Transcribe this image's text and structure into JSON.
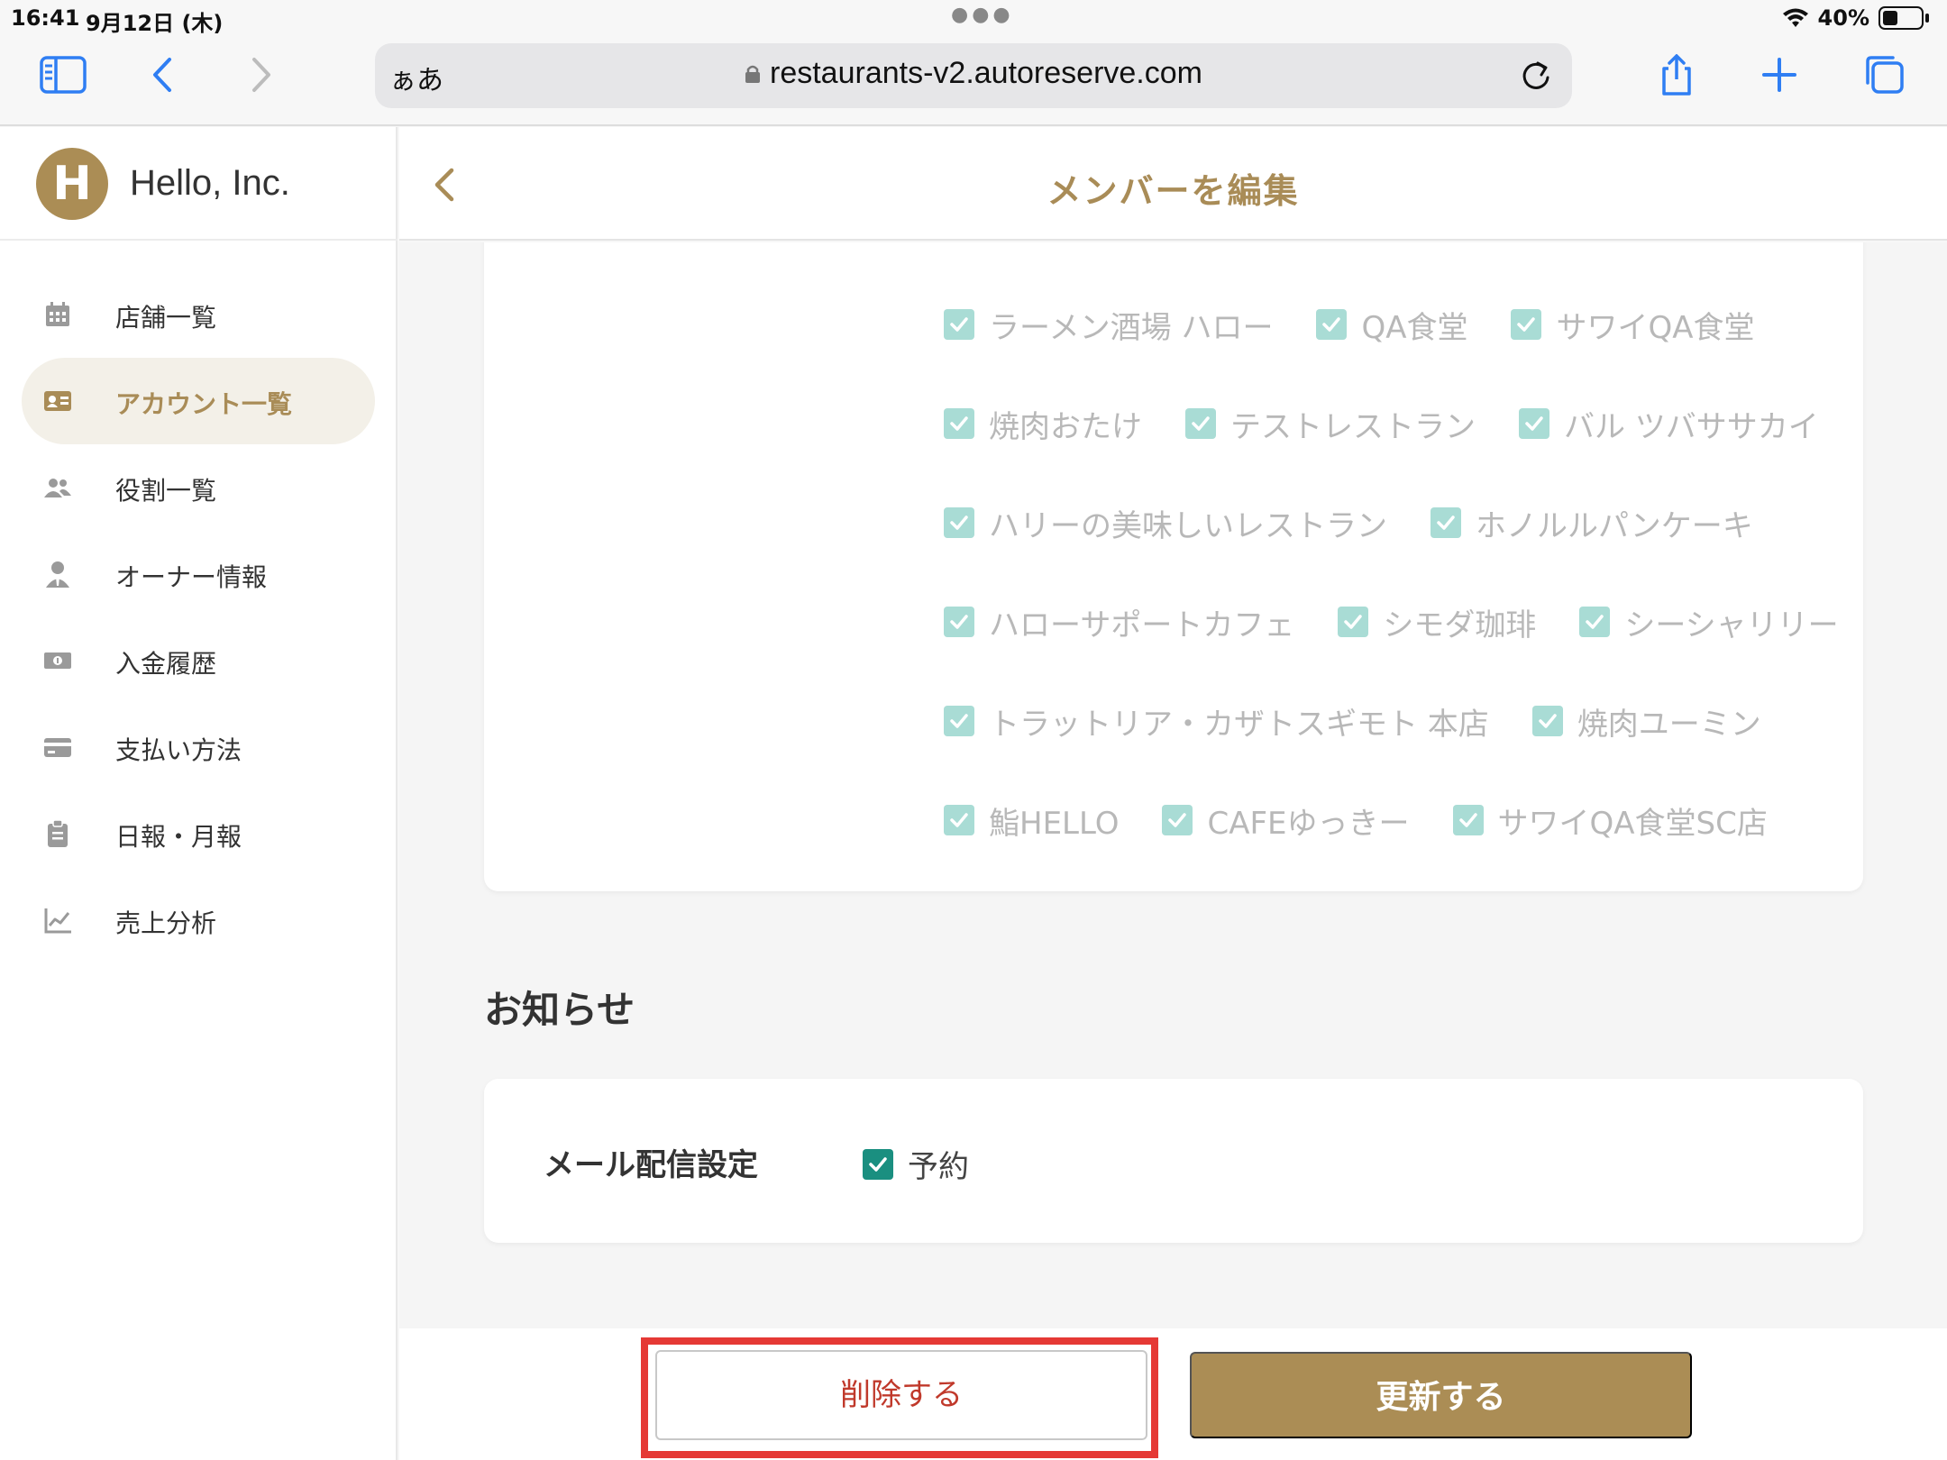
{
  "status_bar": {
    "time": "16:41",
    "date": "9月12日 (木)",
    "battery": "40%"
  },
  "browser": {
    "aa_label": "ぁあ",
    "url": "restaurants-v2.autoreserve.com"
  },
  "brand": {
    "initial": "H",
    "name": "Hello, Inc.",
    "color": "#ab8d55"
  },
  "sidebar": {
    "items": [
      {
        "label": "店舗一覧",
        "icon": "calendar-icon"
      },
      {
        "label": "アカウント一覧",
        "icon": "id-card-icon",
        "active": true
      },
      {
        "label": "役割一覧",
        "icon": "users-icon"
      },
      {
        "label": "オーナー情報",
        "icon": "user-tie-icon"
      },
      {
        "label": "入金履歴",
        "icon": "money-bill-icon"
      },
      {
        "label": "支払い方法",
        "icon": "credit-card-icon"
      },
      {
        "label": "日報・月報",
        "icon": "clipboard-icon"
      },
      {
        "label": "売上分析",
        "icon": "line-chart-icon"
      }
    ]
  },
  "header": {
    "title": "メンバーを編集"
  },
  "stores": {
    "rows": [
      [
        "ラーメン酒場 ハロー",
        "QA食堂",
        "サワイQA食堂"
      ],
      [
        "焼肉おたけ",
        "テストレストラン",
        "バル ツバササカイ"
      ],
      [
        "ハリーの美味しいレストラン",
        "ホノルルパンケーキ"
      ],
      [
        "ハローサポートカフェ",
        "シモダ珈琲",
        "シーシャリリー"
      ],
      [
        "トラットリア・カザトスギモト 本店",
        "焼肉ユーミン"
      ],
      [
        "鮨HELLO",
        "CAFEゆっきー",
        "サワイQA食堂SC店"
      ]
    ],
    "all_checked": true
  },
  "notifications": {
    "section_title": "お知らせ",
    "mail_label": "メール配信設定",
    "option_label": "予約",
    "option_checked": true
  },
  "actions": {
    "delete_label": "削除する",
    "update_label": "更新する"
  },
  "colors": {
    "accent": "#ab8d55",
    "check_disabled": "#a9dcd5",
    "check_active": "#1a8f80",
    "danger": "#c0392b",
    "highlight": "#e53935"
  }
}
